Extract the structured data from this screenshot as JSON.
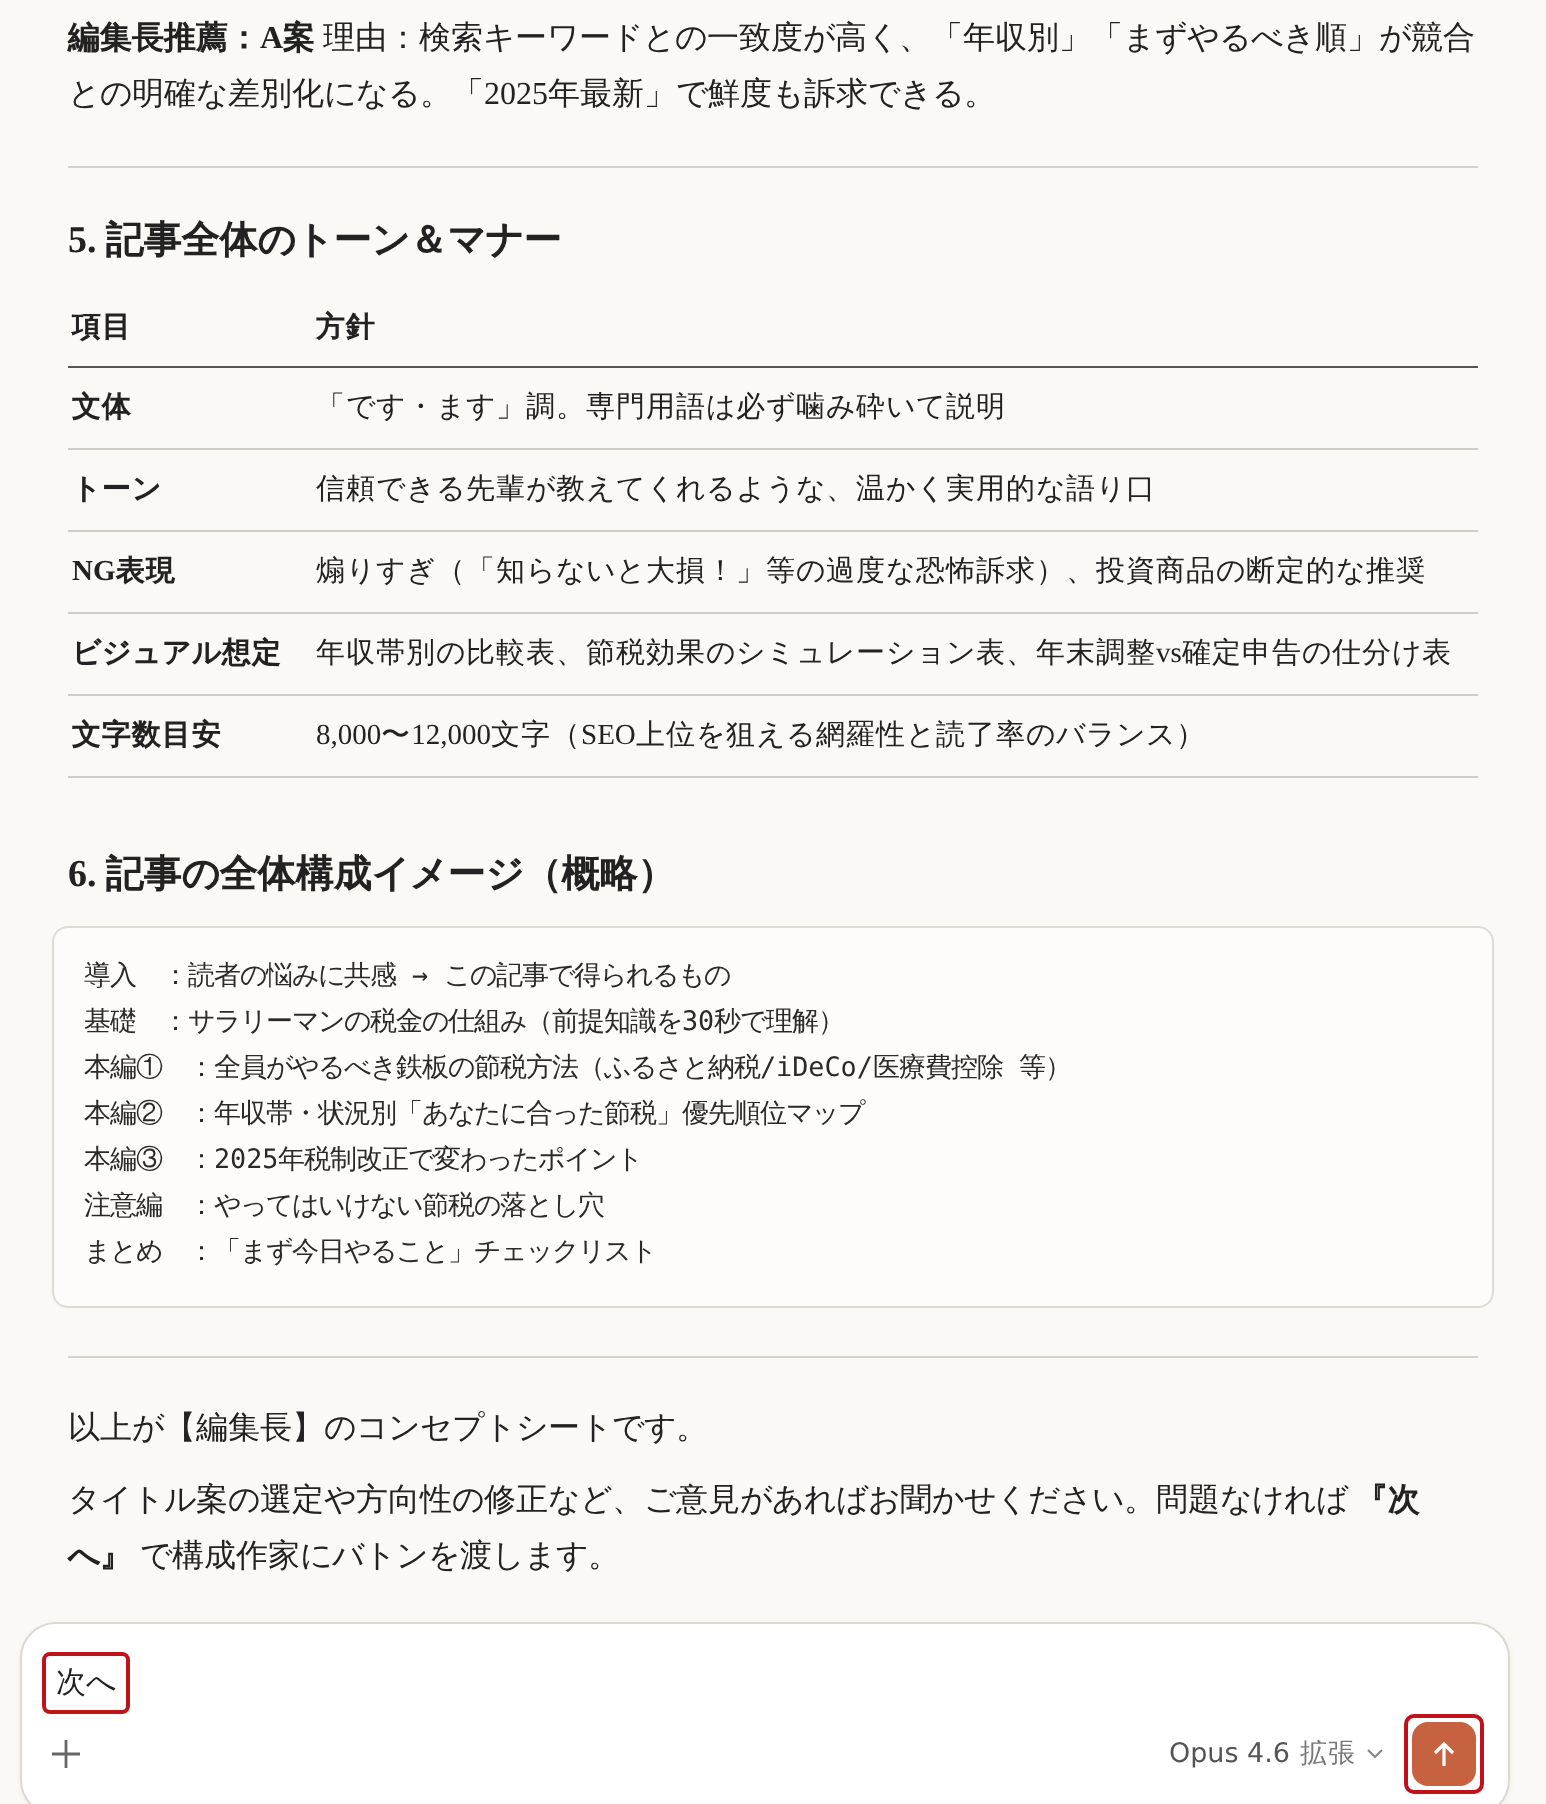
{
  "intro": "**編集長推薦：A案** 理由：検索キーワードとの一致度が高く、「年収別」「まずやるべき順」が競合との明確な差別化になる。「2025年最新」で鮮度も訴求できる。",
  "section5": {
    "number": "5.",
    "title": "記事全体のトーン＆マナー",
    "table": {
      "columns": [
        "項目",
        "方針"
      ],
      "rows": [
        {
          "item": "文体",
          "policy": "「です・ます」調。専門用語は必ず噛み砕いて説明"
        },
        {
          "item": "トーン",
          "policy": "信頼できる先輩が教えてくれるような、温かく実用的な語り口"
        },
        {
          "item": "NG表現",
          "policy": "煽りすぎ（「知らないと大損！」等の過度な恐怖訴求）、投資商品の断定的な推奨"
        },
        {
          "item": "ビジュアル想定",
          "policy": "年収帯別の比較表、節税効果のシミュレーション表、年末調整vs確定申告の仕分け表"
        },
        {
          "item": "文字数目安",
          "policy": "8,000〜12,000文字（SEO上位を狙える網羅性と読了率のバランス）"
        }
      ]
    }
  },
  "section6": {
    "number": "6.",
    "title": "記事の全体構成イメージ（概略）",
    "code_lines": [
      "導入　：読者の悩みに共感 → この記事で得られるもの",
      "基礎　：サラリーマンの税金の仕組み（前提知識を30秒で理解）",
      "本編①　：全員がやるべき鉄板の節税方法（ふるさと納税/iDeCo/医療費控除 等）",
      "本編②　：年収帯・状況別「あなたに合った節税」優先順位マップ",
      "本編③　：2025年税制改正で変わったポイント",
      "注意編　：やってはいけない節税の落とし穴",
      "まとめ　：「まず今日やること」チェックリスト"
    ]
  },
  "closing": [
    "以上が【編集長】のコンセプトシートです。",
    "タイトル案の選定や方向性の修正など、ご意見があればお聞かせください。問題なければ **『次へ』** で構成作家にバトンを渡します。"
  ],
  "composer": {
    "value": "次へ",
    "value_highlighted": true,
    "model": "Opus 4.6",
    "mode": "拡張",
    "send_highlighted": true
  }
}
